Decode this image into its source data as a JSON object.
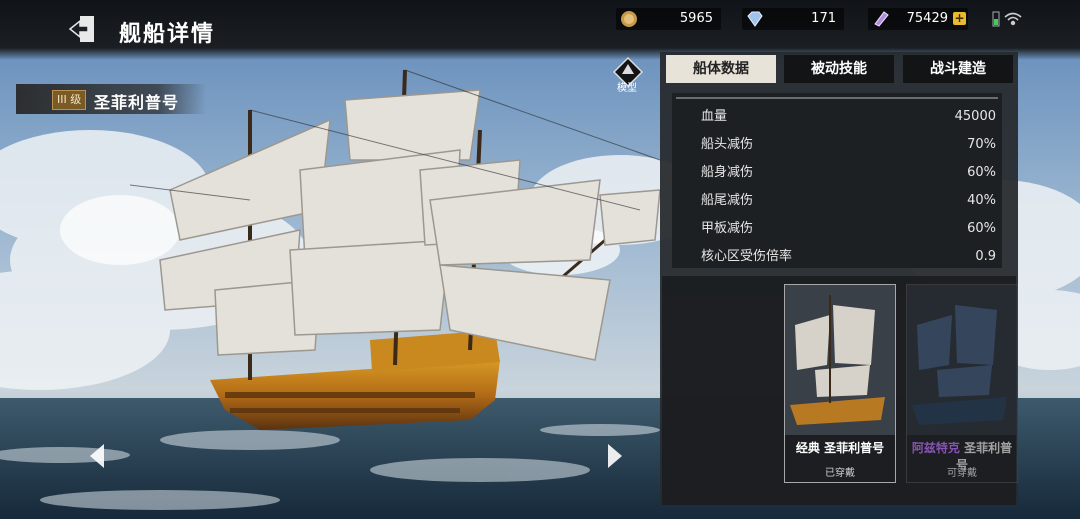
{
  "header": {
    "title": "舰船详情"
  },
  "resources": [
    {
      "icon": "gold-coin-icon",
      "value": "5965"
    },
    {
      "icon": "diamond-icon",
      "value": "171"
    },
    {
      "icon": "crystal-icon",
      "value": "75429"
    }
  ],
  "ship": {
    "tier": "III 级",
    "name": "圣菲利普号"
  },
  "model_button": {
    "label": "模型"
  },
  "tabs": [
    {
      "label": "船体数据",
      "active": true
    },
    {
      "label": "被动技能",
      "active": false
    },
    {
      "label": "战斗建造",
      "active": false
    }
  ],
  "stats": [
    {
      "label": "血量",
      "value": "45000"
    },
    {
      "label": "船头减伤",
      "value": "70%"
    },
    {
      "label": "船身减伤",
      "value": "60%"
    },
    {
      "label": "船尾减伤",
      "value": "40%"
    },
    {
      "label": "甲板减伤",
      "value": "60%"
    },
    {
      "label": "核心区受伤倍率",
      "value": "0.9"
    }
  ],
  "skins": [
    {
      "prefix": "经典",
      "name": "圣菲利普号",
      "status": "已穿戴",
      "prefix_color": "#ffffff"
    },
    {
      "prefix": "阿兹特克",
      "name": "圣菲利普号",
      "status": "可穿戴",
      "prefix_color": "#a866e0"
    }
  ]
}
